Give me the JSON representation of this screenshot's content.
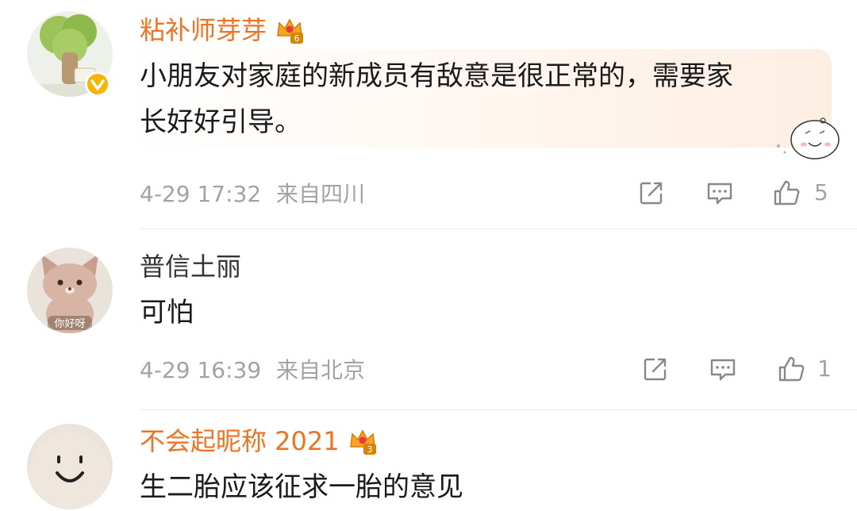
{
  "comments": [
    {
      "username": "粘补师芽芽",
      "crown_level": "6",
      "text_line1": "小朋友对家庭的新成员有敌意是很正常的，需要家",
      "text_line2": "长好好引导。",
      "timestamp": "4-29 17:32",
      "location": "来自四川",
      "likes": "5",
      "avatar_icon": "tree-avatar-icon",
      "verified": true
    },
    {
      "username": "普信土丽",
      "text_line1": "可怕",
      "timestamp": "4-29 16:39",
      "location": "来自北京",
      "likes": "1",
      "avatar_icon": "plush-fox-avatar-icon",
      "avatar_caption": "你好呀"
    },
    {
      "username": "不会起昵称 2021",
      "crown_level": "3",
      "text_line1": "生二胎应该征求一胎的意见",
      "avatar_icon": "smiley-avatar-icon"
    }
  ],
  "colors": {
    "vip_name": "#f2721f",
    "meta": "#a3a3a3",
    "verified_badge": "#f7b500"
  },
  "icons": {
    "share": "share-icon",
    "comment": "comment-icon",
    "like": "thumbs-up-icon"
  }
}
